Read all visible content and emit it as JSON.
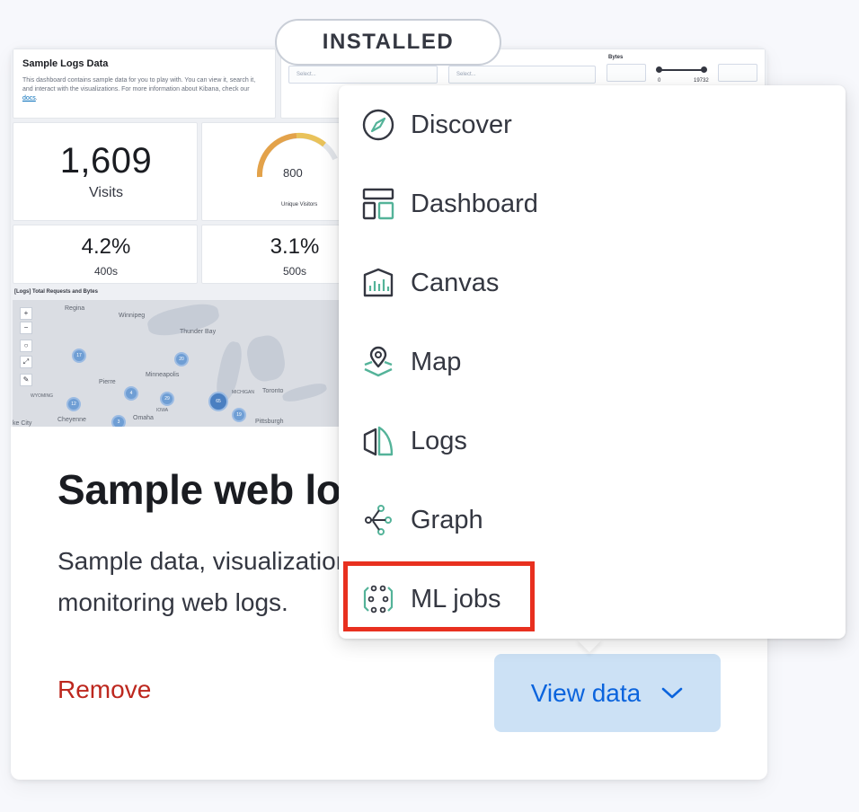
{
  "badge": {
    "label": "INSTALLED"
  },
  "preview": {
    "desc_title": "Sample Logs Data",
    "desc_text_pre": "This dashboard contains sample data for you to play with. You can view it, search it, and interact with the visualizations. For more information about Kibana, check our ",
    "desc_link": "docs",
    "desc_text_post": ".",
    "select_placeholder_1": "Select...",
    "select_placeholder_2": "Select...",
    "bytes_label": "Bytes",
    "range_min": "0",
    "range_max": "19732",
    "visits_value": "1,609",
    "visits_label": "Visits",
    "gauge_value": "800",
    "gauge_label": "Unique Visitors",
    "pct400_value": "4.2%",
    "pct400_label": "400s",
    "pct500_value": "3.1%",
    "pct500_label": "500s",
    "map_title": "[Logs] Total Requests and Bytes",
    "cities": [
      "Regina",
      "Winnipeg",
      "Thunder Bay",
      "Minneapolis",
      "Pierre",
      "WYOMING",
      "IOWA",
      "MICHIGAN",
      "Toronto",
      "Omaha",
      "Cheyenne",
      "Pittsburgh",
      "ke City"
    ],
    "clusters": [
      "17",
      "12",
      "4",
      "29",
      "20",
      "65",
      "3",
      "19"
    ]
  },
  "card": {
    "title": "Sample web logs",
    "description_line1": "Sample data, visualizations, and dashboards for",
    "description_line2": "monitoring web logs.",
    "remove_label": "Remove",
    "view_data_label": "View data"
  },
  "menu": {
    "items": [
      {
        "label": "Discover",
        "icon": "compass-icon"
      },
      {
        "label": "Dashboard",
        "icon": "dashboard-icon"
      },
      {
        "label": "Canvas",
        "icon": "canvas-icon"
      },
      {
        "label": "Map",
        "icon": "map-icon"
      },
      {
        "label": "Logs",
        "icon": "logs-icon"
      },
      {
        "label": "Graph",
        "icon": "graph-icon"
      },
      {
        "label": "ML jobs",
        "icon": "ml-icon"
      }
    ]
  },
  "colors": {
    "accent": "#0b64dd",
    "danger": "#bd271e",
    "highlight": "#e8301f",
    "icon_teal": "#54b399"
  }
}
